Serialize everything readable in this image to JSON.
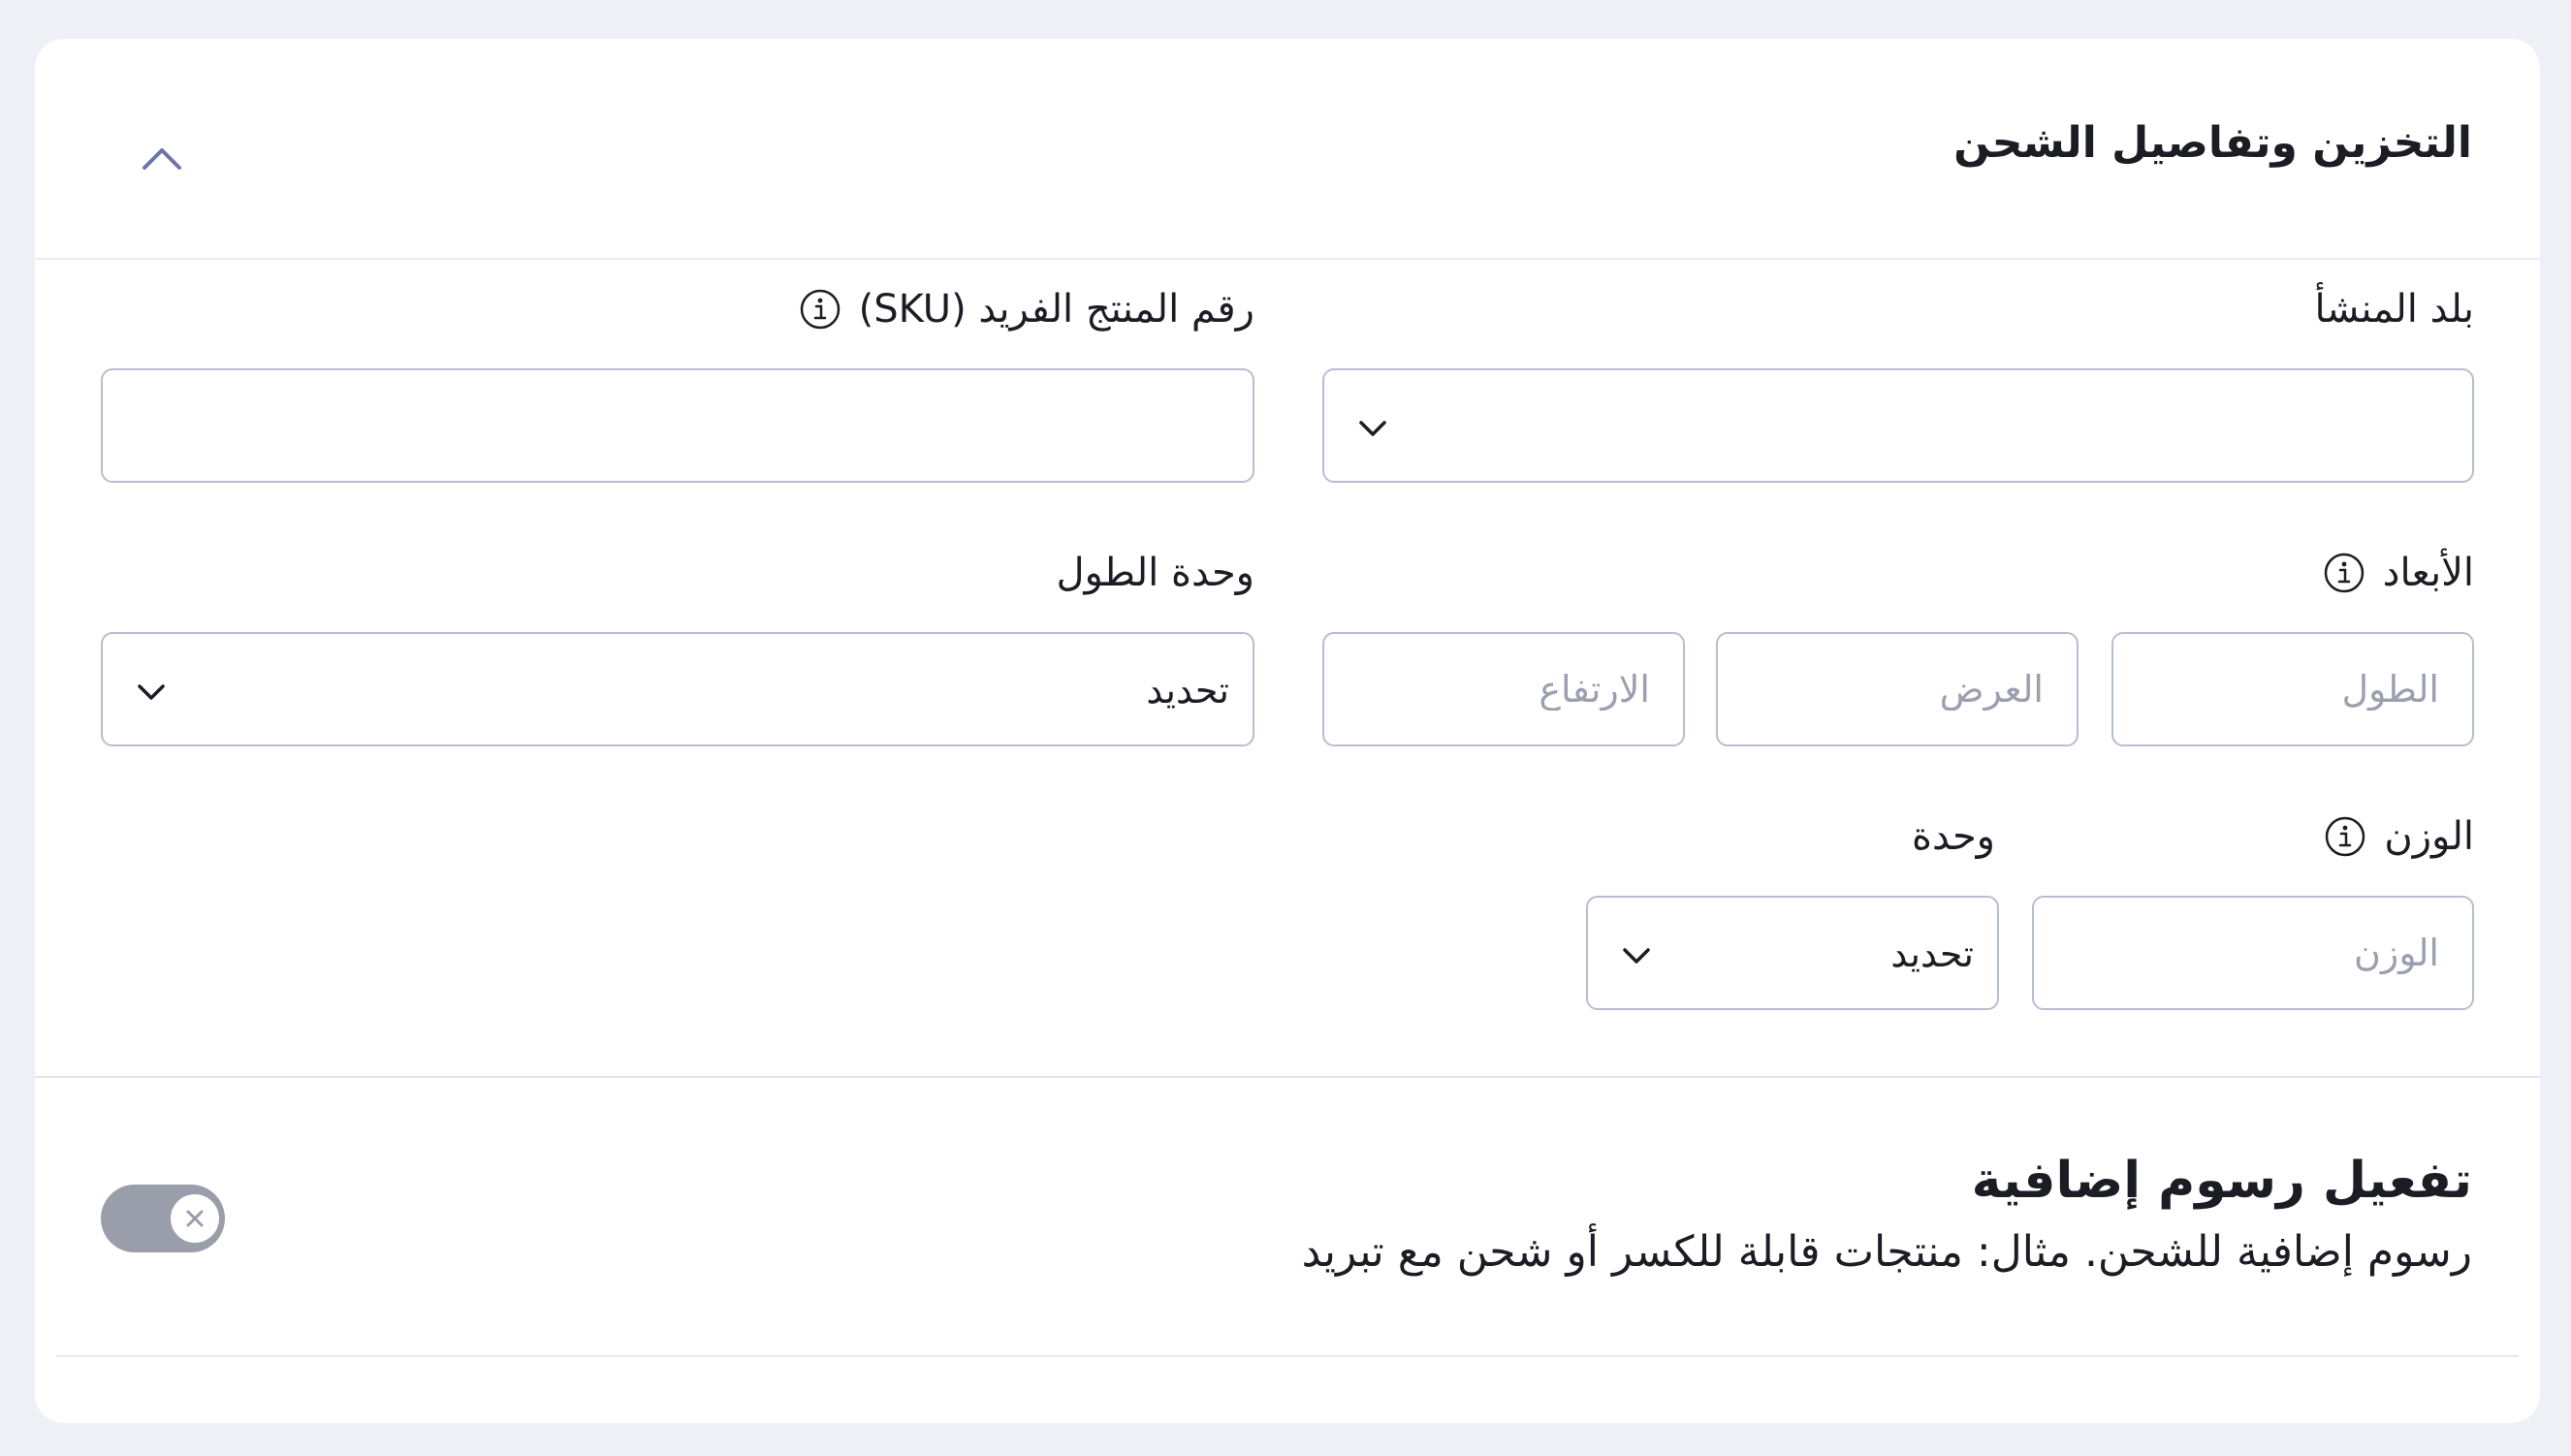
{
  "section": {
    "title": "التخزين وتفاصيل الشحن"
  },
  "origin": {
    "label": "بلد المنشأ",
    "value": ""
  },
  "sku": {
    "label": "رقم المنتج الفريد (SKU)",
    "value": ""
  },
  "dimensions": {
    "label": "الأبعاد",
    "length_placeholder": "الطول",
    "width_placeholder": "العرض",
    "height_placeholder": "الارتفاع"
  },
  "length_unit": {
    "label": "وحدة الطول",
    "value": "تحديد"
  },
  "weight": {
    "label": "الوزن",
    "placeholder": "الوزن"
  },
  "weight_unit": {
    "label": "وحدة",
    "value": "تحديد"
  },
  "extra_fees": {
    "title": "تفعيل رسوم إضافية",
    "description": "رسوم إضافية للشحن. مثال: منتجات قابلة للكسر أو شحن مع تبريد",
    "enabled": false
  },
  "colors": {
    "accent": "#6b76a8",
    "border": "#b9bdd2",
    "toggle_off": "#9a9eaa"
  },
  "icons": {
    "collapse": "chevron-up-icon",
    "info": "info-circle-icon",
    "dropdown": "chevron-down-icon",
    "toggle_off": "close-icon"
  }
}
